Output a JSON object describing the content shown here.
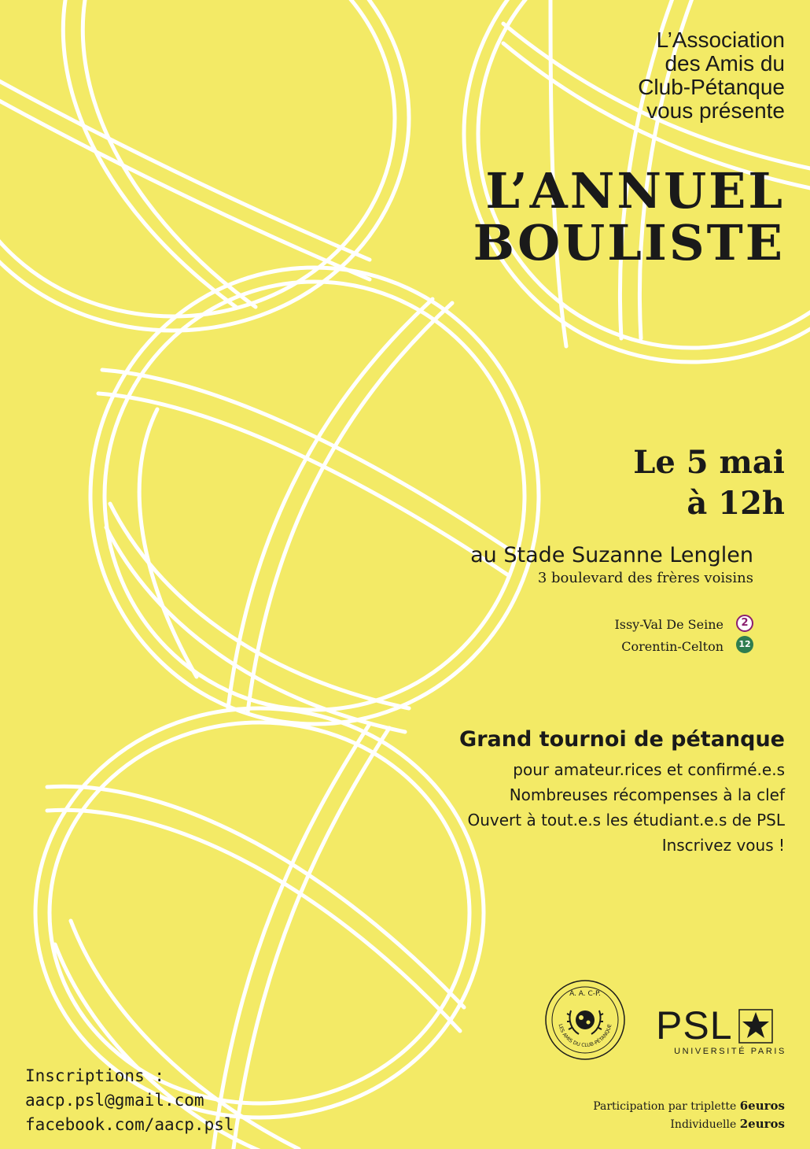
{
  "presenter": {
    "line1": "L’Association",
    "line2": "des Amis du",
    "line3": "Club-Pétanque",
    "line4": "vous présente"
  },
  "title": {
    "line1": "L’ANNUEL",
    "line2": "BOULISTE"
  },
  "date": {
    "day": "Le 5 mai",
    "time": "à 12h"
  },
  "venue": {
    "name": "au Stade Suzanne Lenglen",
    "address": "3 boulevard des frères voisins"
  },
  "metro": [
    {
      "station": "Issy-Val De Seine",
      "line": "2",
      "color": "#8b1f6f"
    },
    {
      "station": "Corentin-Celton",
      "line": "12",
      "color": "#2f7d4f"
    }
  ],
  "tournament": {
    "title": "Grand tournoi de pétanque",
    "details": [
      "pour amateur.rices et confirmé.e.s",
      "Nombreuses récompenses à la clef",
      "Ouvert à tout.e.s les étudiant.e.s de PSL",
      "Inscrivez vous !"
    ]
  },
  "logos": {
    "aacp": {
      "top_text": "A. A. C-P.",
      "ring_text": "LES AMIS DU CLUB-PÉTANQUE"
    },
    "psl": {
      "name": "PSL",
      "subtitle": "UNIVERSITÉ PARIS",
      "icon": "star-icon"
    }
  },
  "inscriptions": {
    "label": "Inscriptions :",
    "email": "aacp.psl@gmail.com",
    "facebook": "facebook.com/aacp.psl"
  },
  "prices": {
    "triplet_label": "Participation par triplette",
    "triplet_price": "6euros",
    "single_label": "Individuelle",
    "single_price": "2euros"
  },
  "colors": {
    "background": "#f3ea66",
    "line_art": "#ffffff",
    "text": "#1a1a1a"
  }
}
